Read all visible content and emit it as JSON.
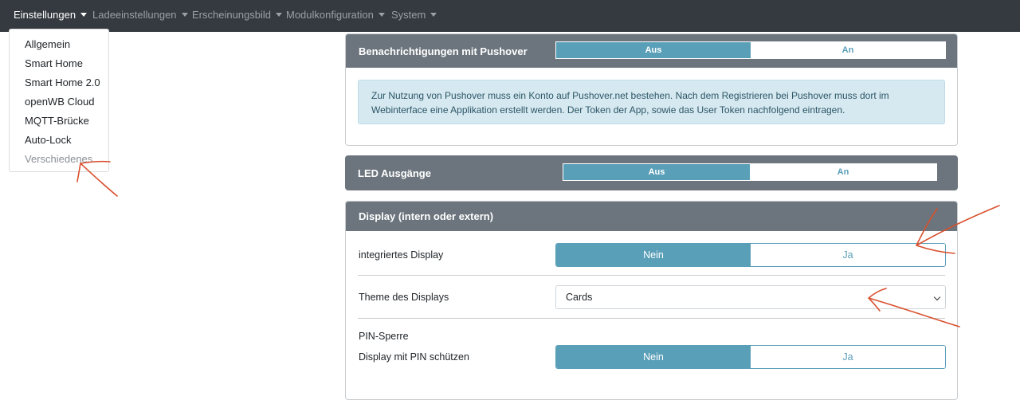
{
  "nav": {
    "items": [
      {
        "label": "Einstellungen",
        "active": true
      },
      {
        "label": "Ladeeinstellungen",
        "active": false
      },
      {
        "label": "Erscheinungsbild",
        "active": false
      },
      {
        "label": "Modulkonfiguration",
        "active": false
      },
      {
        "label": "System",
        "active": false
      }
    ]
  },
  "dropdown": {
    "items": [
      "Allgemein",
      "Smart Home",
      "Smart Home 2.0",
      "openWB Cloud",
      "MQTT-Brücke",
      "Auto-Lock",
      "Verschiedenes"
    ]
  },
  "pushover": {
    "title": "Benachrichtigungen mit Pushover",
    "toggle": {
      "off_label": "Aus",
      "on_label": "An",
      "selected": "Aus"
    },
    "info": "Zur Nutzung von Pushover muss ein Konto auf Pushover.net bestehen. Nach dem Registrieren bei Pushover muss dort im Webinterface eine Applikation erstellt werden. Der Token der App, sowie das User Token nachfolgend eintragen."
  },
  "led": {
    "title": "LED Ausgänge",
    "toggle": {
      "off_label": "Aus",
      "on_label": "An",
      "selected": "Aus"
    }
  },
  "display": {
    "title": "Display (intern oder extern)",
    "integrated": {
      "label": "integriertes Display",
      "no_label": "Nein",
      "yes_label": "Ja",
      "selected": "Nein"
    },
    "theme": {
      "label": "Theme des Displays",
      "value": "Cards"
    },
    "pin": {
      "section_label": "PIN-Sperre",
      "label": "Display mit PIN schützen",
      "no_label": "Nein",
      "yes_label": "Ja",
      "selected": "Nein"
    }
  },
  "colors": {
    "navbar": "#343a40",
    "card_header": "#6c757d",
    "toggle_active": "#5a9fb8",
    "annotation": "#d9502e"
  }
}
